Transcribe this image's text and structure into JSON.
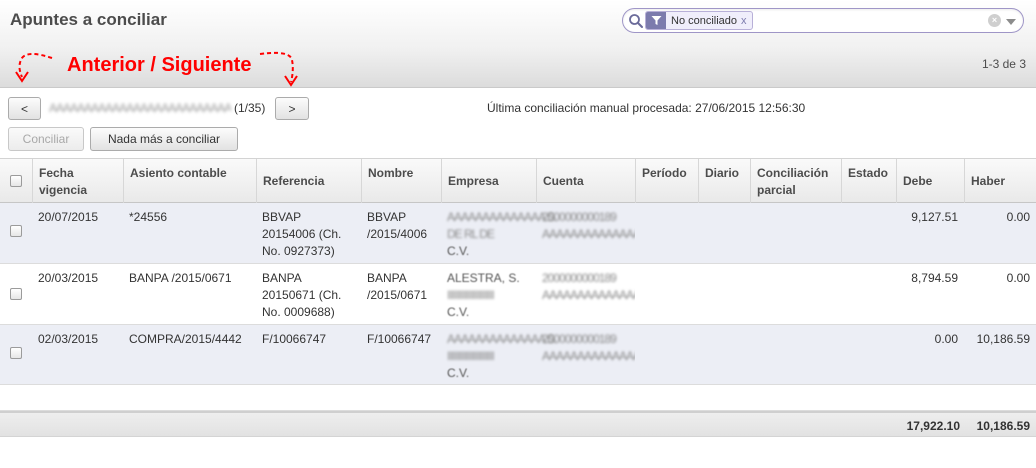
{
  "header": {
    "title": "Apuntes a conciliar",
    "pager": "1-3 de 3"
  },
  "search": {
    "facet_label": "No conciliado",
    "facet_remove": "x",
    "clear_glyph": "×",
    "placeholder": ""
  },
  "annotation": {
    "text": "Anterior / Siguiente",
    "color": "#ff0000"
  },
  "nav": {
    "prev_label": "<",
    "next_label": ">",
    "partner_name": "AAAAAAAAAAAAAAAAAAAAAAAAAAAAAAA",
    "partner_count": "(1/35)",
    "last_reconcile": "Última conciliación manual procesada: 27/06/2015 12:56:30"
  },
  "actions": {
    "reconcile_label": "Conciliar",
    "nothing_label": "Nada más a conciliar"
  },
  "table": {
    "columns": {
      "fecha": "Fecha vigencia",
      "asiento": "Asiento contable",
      "referencia": "Referencia",
      "nombre": "Nombre",
      "empresa": "Empresa",
      "cuenta": "Cuenta",
      "periodo": "Período",
      "diario": "Diario",
      "conciliacion": "Conciliación parcial",
      "estado": "Estado",
      "debe": "Debe",
      "haber": "Haber"
    },
    "rows": [
      {
        "fecha": "20/07/2015",
        "asiento": "*24556",
        "referencia": "BBVAP 20154006 (Ch. No. 0927373)",
        "nombre": "BBVAP /2015/4006",
        "empresa_l1": "AAAAAAAAAAAAAA S.",
        "empresa_l2": "DE RL DE",
        "empresa_l3": "C.V.",
        "cuenta_l1": "2000000000189",
        "cuenta_l2": "AAAAAAAAAAAAAAAA",
        "debe": "9,127.51",
        "haber": "0.00"
      },
      {
        "fecha": "20/03/2015",
        "asiento": "BANPA /2015/0671",
        "referencia": "BANPA 20150671 (Ch. No. 0009688)",
        "nombre": "BANPA /2015/0671",
        "empresa_l1": "ALESTRA, S.",
        "empresa_l2": "IIIIIIIIIIIIIIIIIIII",
        "empresa_l3": "C.V.",
        "cuenta_l1": "2000000000189",
        "cuenta_l2": "AAAAAAAAAAAAAAAA",
        "debe": "8,794.59",
        "haber": "0.00"
      },
      {
        "fecha": "02/03/2015",
        "asiento": "COMPRA/2015/4442",
        "referencia": "F/10066747",
        "nombre": "F/10066747",
        "empresa_l1": "AAAAAAAAAAAAAA S.",
        "empresa_l2": "IIIIIIIIIIIIIIIIIIII",
        "empresa_l3": "C.V.",
        "cuenta_l1": "2000000000189",
        "cuenta_l2": "AAAAAAAAAAAAAAAA",
        "debe": "0.00",
        "haber": "10,186.59"
      }
    ],
    "totals": {
      "debe": "17,922.10",
      "haber": "10,186.59"
    }
  },
  "icons": {
    "search": "search-icon",
    "filter": "filter-icon",
    "clear": "clear-icon",
    "drawer": "drawer-toggle-icon"
  }
}
